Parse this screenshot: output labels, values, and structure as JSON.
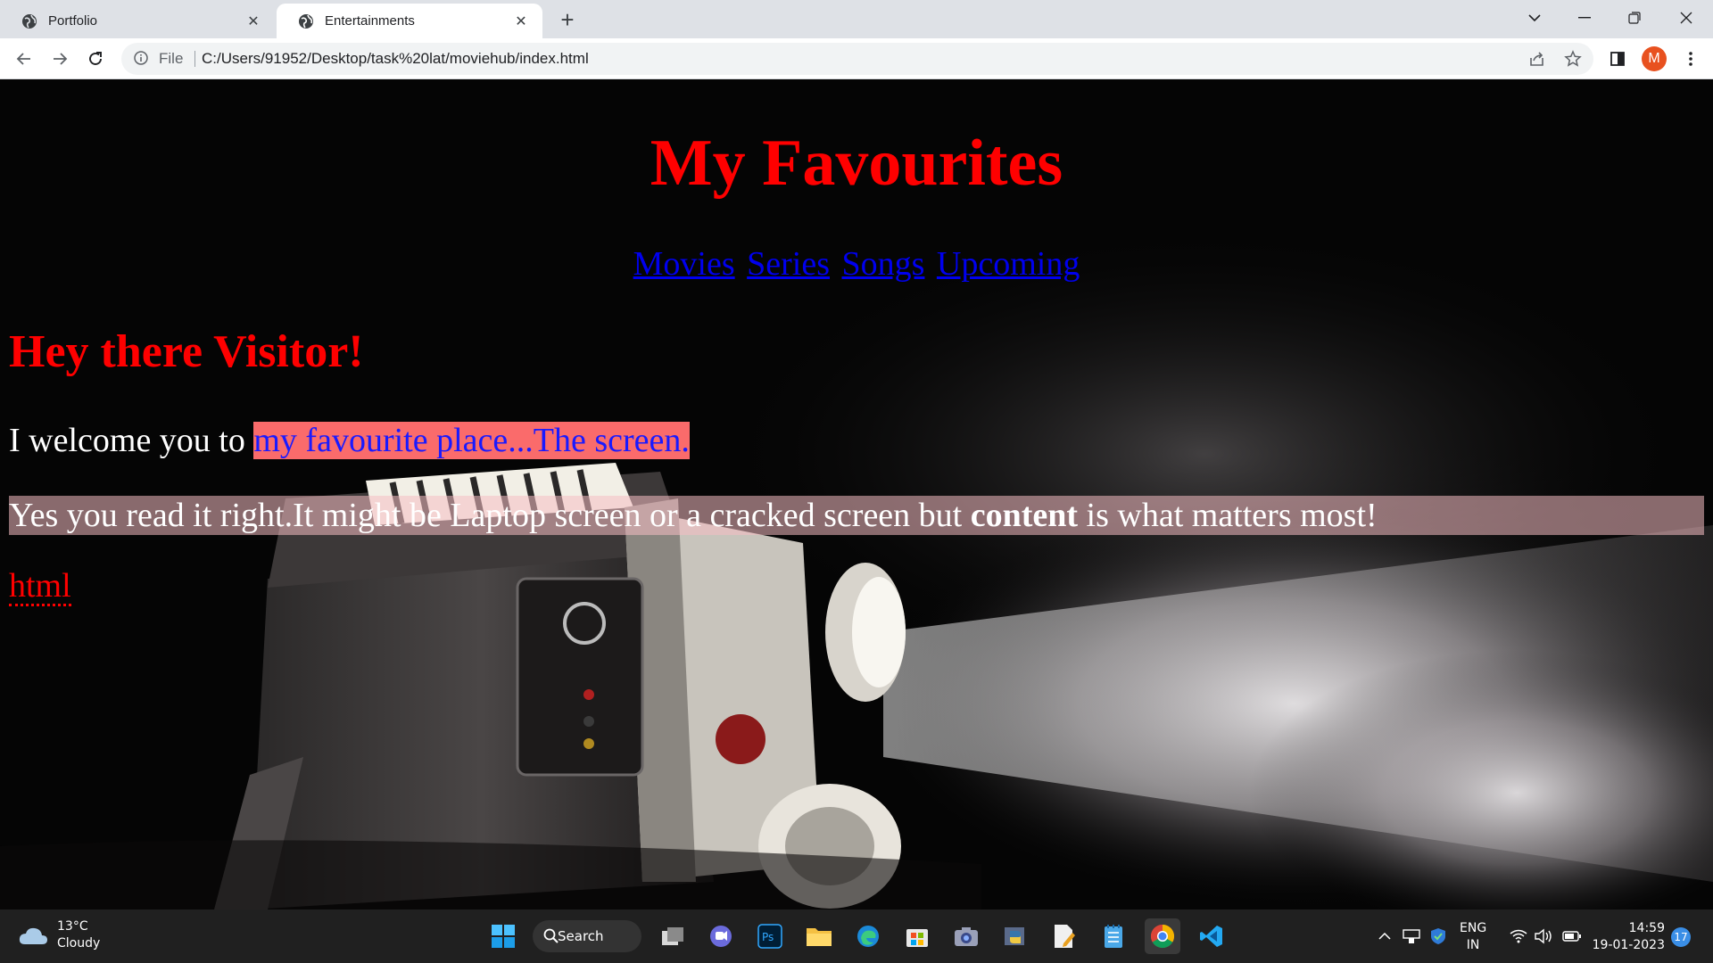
{
  "browser": {
    "tabs": [
      {
        "title": "Portfolio",
        "active": false
      },
      {
        "title": "Entertainments",
        "active": true
      }
    ],
    "address": {
      "scheme_label": "File",
      "url": "C:/Users/91952/Desktop/task%20lat/moviehub/index.html"
    },
    "profile_initial": "M",
    "profile_color": "#e8511f"
  },
  "page": {
    "title": "My Favourites",
    "nav_links": [
      "Movies",
      "Series",
      "Songs",
      "Upcoming"
    ],
    "greeting": "Hey there Visitor!",
    "welcome_prefix": "I welcome you to ",
    "welcome_highlight": "my favourite place...The screen.",
    "yes_prefix": "Yes you read it right.It might be Laptop screen or a cracked screen but ",
    "yes_bold": "content",
    "yes_suffix": " is what matters most!",
    "abbr_text": "html",
    "colors": {
      "heading": "#ff0000",
      "link": "#0000ee",
      "highlight_bg": "#fa6b6b",
      "highlight_text": "#1a1aff"
    }
  },
  "taskbar": {
    "weather": {
      "temp": "13°C",
      "condition": "Cloudy"
    },
    "search_label": "Search",
    "language": {
      "line1": "ENG",
      "line2": "IN"
    },
    "clock": {
      "time": "14:59",
      "date": "19-01-2023"
    },
    "notification_count": "17"
  }
}
